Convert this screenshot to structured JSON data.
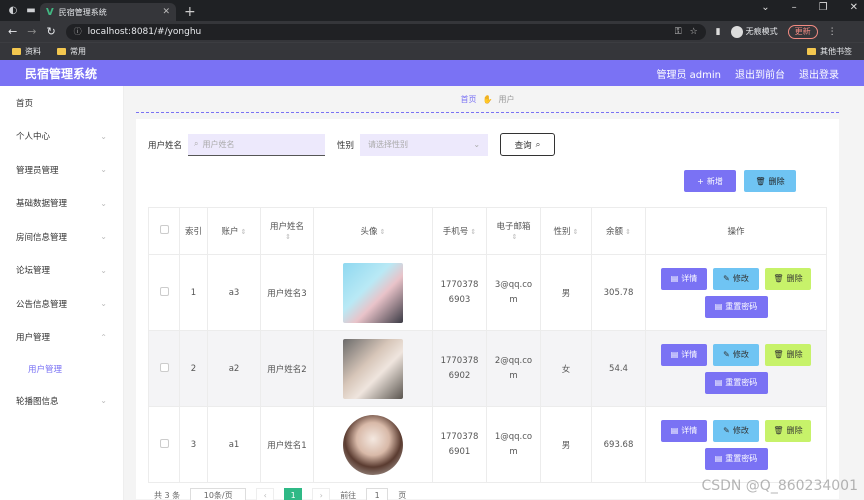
{
  "browser": {
    "tab_title": "民宿管理系统",
    "url": "localhost:8081/#/yonghu",
    "incognito": "无痕模式",
    "update": "更新",
    "bookmarks": [
      "资料",
      "常用"
    ],
    "other_bookmarks": "其他书签"
  },
  "header": {
    "title": "民宿管理系统",
    "admin": "管理员 admin",
    "to_front": "退出到前台",
    "logout": "退出登录"
  },
  "sidebar": {
    "items": [
      {
        "label": "首页"
      },
      {
        "label": "个人中心"
      },
      {
        "label": "管理员管理"
      },
      {
        "label": "基础数据管理"
      },
      {
        "label": "房间信息管理"
      },
      {
        "label": "论坛管理"
      },
      {
        "label": "公告信息管理"
      },
      {
        "label": "用户管理"
      },
      {
        "label": "轮播图信息"
      }
    ],
    "sub": "用户管理"
  },
  "breadcrumb": {
    "home": "首页",
    "current": "用户"
  },
  "search": {
    "name_label": "用户姓名",
    "name_placeholder": "用户姓名",
    "gender_label": "性别",
    "gender_placeholder": "请选择性别",
    "query": "查询"
  },
  "buttons": {
    "add": "新增",
    "delete": "删除"
  },
  "table": {
    "headers": [
      "索引",
      "账户",
      "用户姓名",
      "头像",
      "手机号",
      "电子邮箱",
      "性别",
      "余额",
      "操作"
    ],
    "rows": [
      {
        "index": "1",
        "account": "a3",
        "name": "用户姓名3",
        "phone": "17703786903",
        "email": "3@qq.com",
        "gender": "男",
        "balance": "305.78"
      },
      {
        "index": "2",
        "account": "a2",
        "name": "用户姓名2",
        "phone": "17703786902",
        "email": "2@qq.com",
        "gender": "女",
        "balance": "54.4"
      },
      {
        "index": "3",
        "account": "a1",
        "name": "用户姓名1",
        "phone": "17703786901",
        "email": "1@qq.com",
        "gender": "男",
        "balance": "693.68"
      }
    ],
    "ops": {
      "detail": "详情",
      "edit": "修改",
      "delete": "删除",
      "reset": "重置密码"
    }
  },
  "pager": {
    "total": "共 3 条",
    "size": "10条/页",
    "current": "1",
    "goto": "前往",
    "goto_value": "1",
    "page": "页"
  },
  "watermark": "CSDN @Q_860234001"
}
